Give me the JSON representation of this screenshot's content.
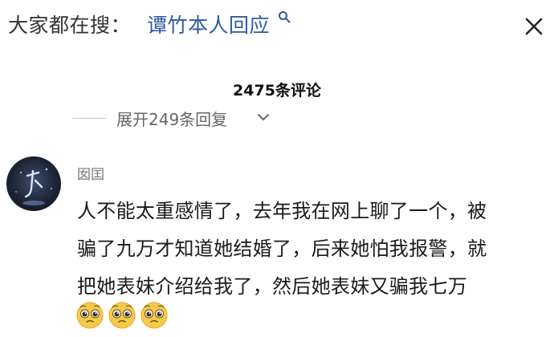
{
  "search": {
    "prefix": "大家都在搜：",
    "query": "谭竹本人回应",
    "search_icon": "search-icon",
    "close_icon": "close-icon"
  },
  "comments": {
    "count_label": "2475条评论",
    "expand_label": "展开249条回复",
    "expand_icon": "chevron-down-icon"
  },
  "comment": {
    "username": "囡囯",
    "lines": [
      "人不能太重感情了，去年我在网上聊了一个，被",
      "骗了九万才知道她结婚了，后来她怕我报警，就",
      "把她表妹介绍给我了，然后她表妹又骗我七万"
    ],
    "emojis": [
      "pleading-face",
      "pleading-face",
      "pleading-face"
    ]
  },
  "colors": {
    "link_blue": "#2e5a9f",
    "muted_gray": "#777777",
    "emoji_yellow": "#f7c948"
  }
}
